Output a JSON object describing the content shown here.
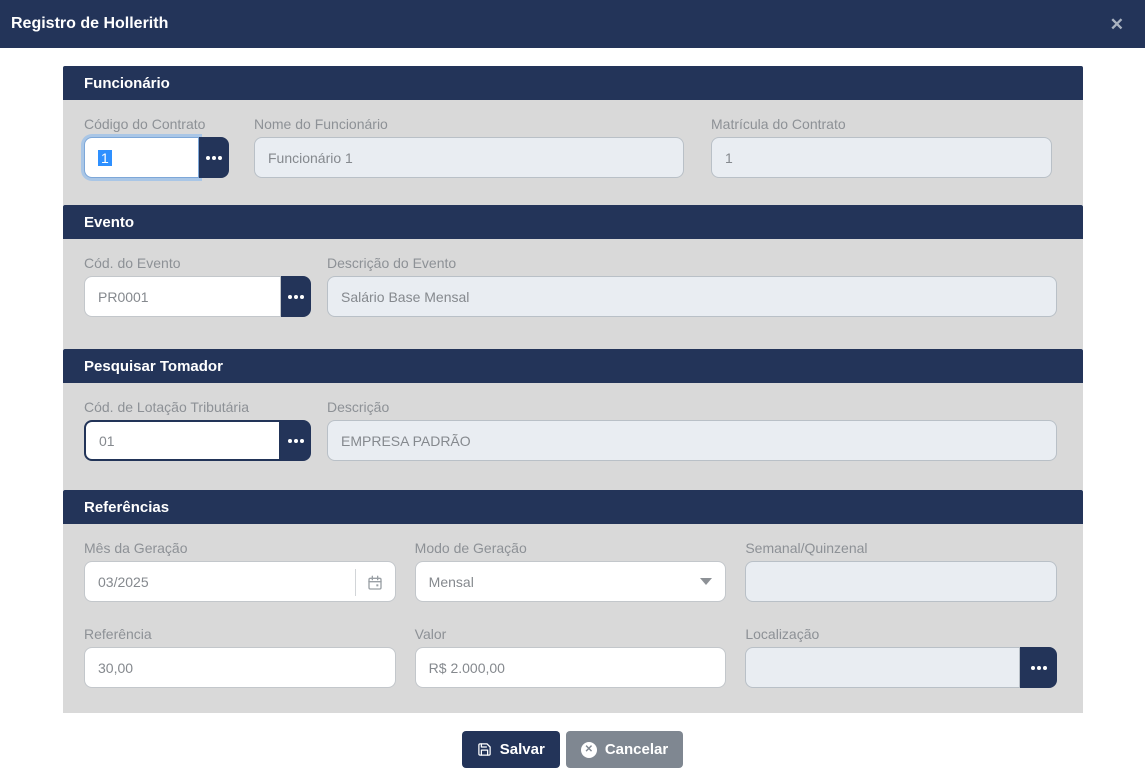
{
  "modal": {
    "title": "Registro de Hollerith",
    "close_glyph": "✕"
  },
  "sections": {
    "funcionario": {
      "title": "Funcionário",
      "fields": {
        "codigo_contrato": {
          "label": "Código do Contrato",
          "value": "1"
        },
        "nome_funcionario": {
          "label": "Nome do Funcionário",
          "value": "Funcionário 1"
        },
        "matricula_contrato": {
          "label": "Matrícula do Contrato",
          "value": "1"
        }
      }
    },
    "evento": {
      "title": "Evento",
      "fields": {
        "cod_evento": {
          "label": "Cód. do Evento",
          "value": "PR0001"
        },
        "descricao_evento": {
          "label": "Descrição do Evento",
          "value": "Salário Base Mensal"
        }
      }
    },
    "pesquisar_tomador": {
      "title": "Pesquisar Tomador",
      "fields": {
        "cod_lotacao": {
          "label": "Cód. de Lotação Tributária",
          "value": "01"
        },
        "descricao": {
          "label": "Descrição",
          "value": "EMPRESA PADRÃO"
        }
      }
    },
    "referencias": {
      "title": "Referências",
      "fields": {
        "mes_geracao": {
          "label": "Mês da Geração",
          "value": "03/2025"
        },
        "modo_geracao": {
          "label": "Modo de Geração",
          "value": "Mensal"
        },
        "semanal_quinzenal": {
          "label": "Semanal/Quinzenal",
          "value": ""
        },
        "referencia": {
          "label": "Referência",
          "value": "30,00"
        },
        "valor": {
          "label": "Valor",
          "value": "R$ 2.000,00"
        },
        "localizacao": {
          "label": "Localização",
          "value": ""
        }
      }
    }
  },
  "footer": {
    "save_label": "Salvar",
    "cancel_label": "Cancelar",
    "cancel_glyph": "✕"
  },
  "colors": {
    "navy": "#233459",
    "panel_gray": "#d9d9d9",
    "readonly_bg": "#e9edf2",
    "cancel_gray": "#7f8791",
    "selection_blue": "#2e90ff"
  }
}
